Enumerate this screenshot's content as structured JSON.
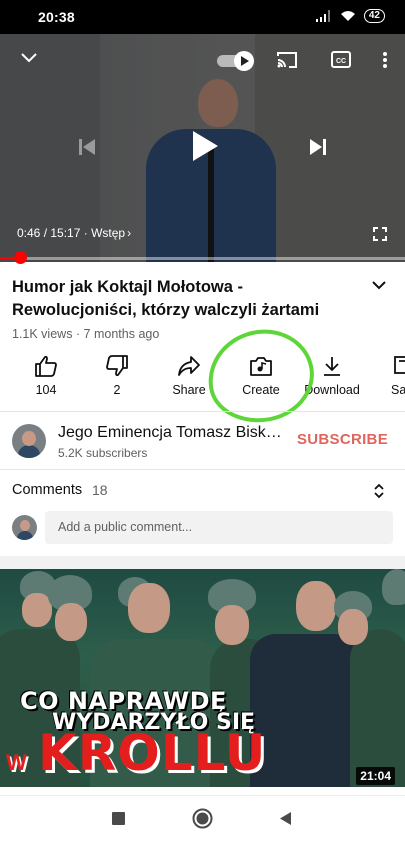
{
  "status_bar": {
    "time": "20:38",
    "battery": "42"
  },
  "player": {
    "time_current": "0:46",
    "time_total": "15:17",
    "chapter": "Wstęp",
    "progress": 0.05
  },
  "video": {
    "title": "Humor jak Koktajl Mołotowa - Rewolucjoniści, którzy walczyli żartami",
    "meta": "1.1K views · 7 months ago"
  },
  "actions": [
    {
      "label": "104",
      "icon": "like-icon"
    },
    {
      "label": "2",
      "icon": "dislike-icon"
    },
    {
      "label": "Share",
      "icon": "share-icon"
    },
    {
      "label": "Create",
      "icon": "create-icon"
    },
    {
      "label": "Download",
      "icon": "download-icon"
    },
    {
      "label": "Sa",
      "icon": "save-icon"
    }
  ],
  "channel": {
    "name": "Jego Eminencja Tomasz Bisk…",
    "subscribers": "5.2K subscribers",
    "subscribe_label": "SUBSCRIBE"
  },
  "comments": {
    "title": "Comments",
    "count": "18",
    "placeholder": "Add a public comment..."
  },
  "next_video": {
    "line1": "CO NAPRAWDĘ",
    "line2": "WYDARZYŁO SIĘ",
    "line3": "KROLLU",
    "prefix": "W",
    "duration": "21:04"
  },
  "colors": {
    "accent": "#ff0000",
    "subscribe": "#e0665d",
    "annotation": "#5ed63a"
  }
}
